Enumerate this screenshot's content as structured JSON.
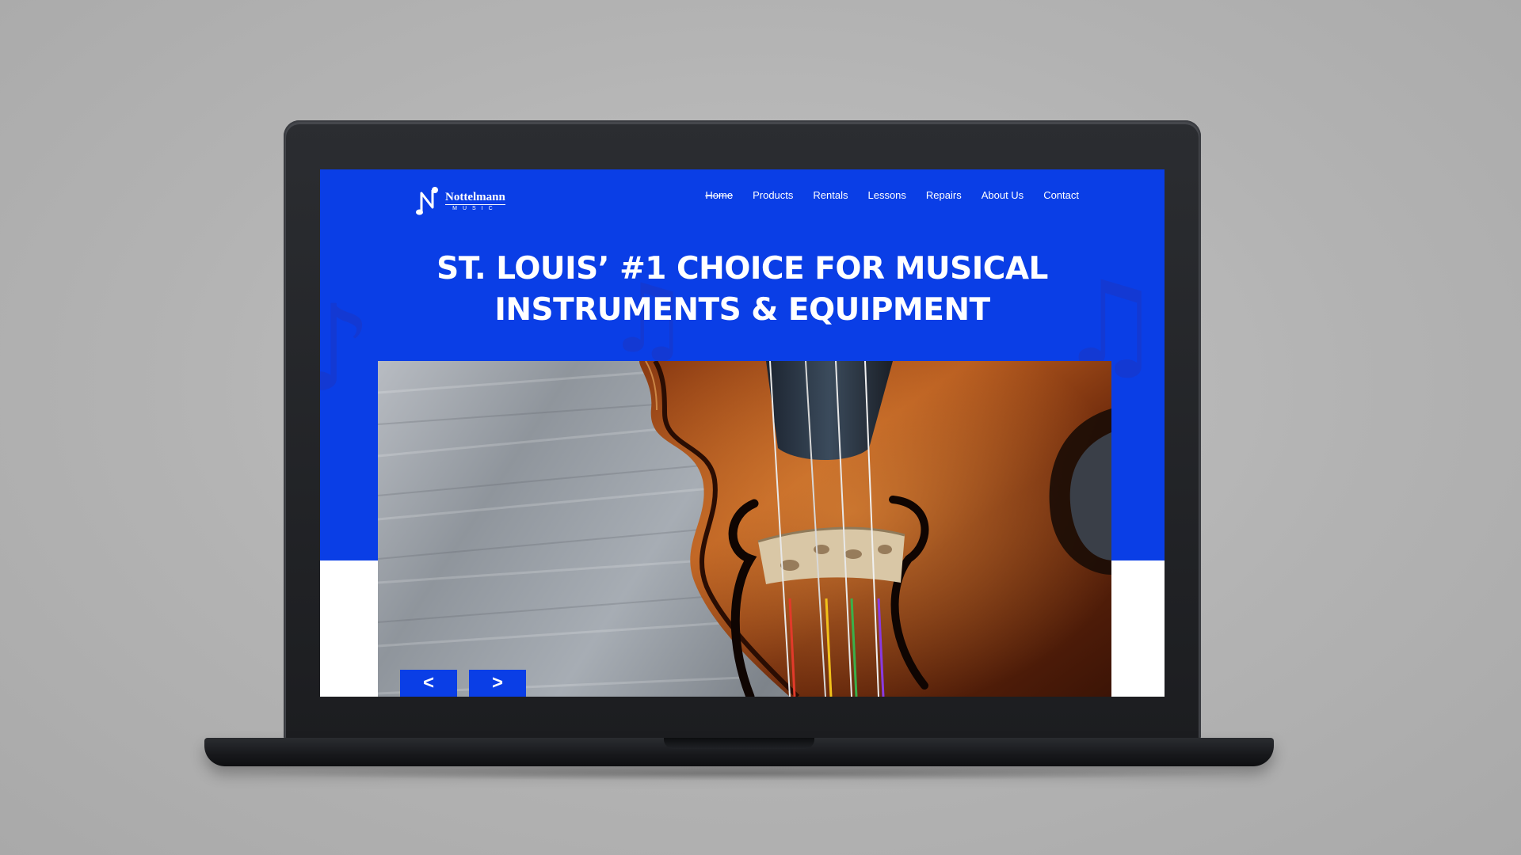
{
  "brand": {
    "name": "Nottelmann",
    "sub": "MUSIC",
    "logo_icon": "music-note-logo-icon",
    "color": "#ffffff"
  },
  "nav": {
    "items": [
      {
        "label": "Home",
        "active": true
      },
      {
        "label": "Products",
        "active": false
      },
      {
        "label": "Rentals",
        "active": false
      },
      {
        "label": "Lessons",
        "active": false
      },
      {
        "label": "Repairs",
        "active": false
      },
      {
        "label": "About Us",
        "active": false
      },
      {
        "label": "Contact",
        "active": false
      }
    ]
  },
  "hero": {
    "title_line1": "ST. LOUIS’ #1 CHOICE FOR MUSICAL",
    "title_line2": "INSTRUMENTS & EQUIPMENT",
    "image": "violin-closeup-photo",
    "background_color": "#0a3ee6"
  },
  "slider": {
    "prev_label": "<",
    "next_label": ">"
  }
}
